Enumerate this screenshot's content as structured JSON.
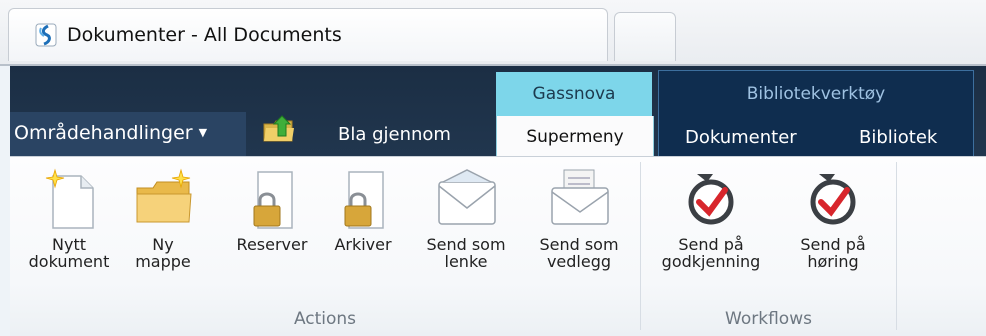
{
  "browser": {
    "tab_title": "Dokumenter - All Documents"
  },
  "ribbon": {
    "area_actions_label": "Områdehandlinger",
    "tabs": {
      "browse": "Bla gjennom",
      "gassnova_context": "Gassnova",
      "supermeny": "Supermeny",
      "library_tools_context": "Bibliotekverktøy",
      "documents": "Dokumenter",
      "library": "Bibliotek"
    },
    "groups": {
      "actions": "Actions",
      "workflows": "Workflows"
    },
    "commands": [
      {
        "label": "Nytt\ndokument",
        "icon": "new-document-icon"
      },
      {
        "label": "Ny\nmappe",
        "icon": "new-folder-icon"
      },
      {
        "label": "Reserver",
        "icon": "checkout-lock-icon"
      },
      {
        "label": "Arkiver",
        "icon": "archive-lock-icon"
      },
      {
        "label": "Send som\nlenke",
        "icon": "envelope-link-icon"
      },
      {
        "label": "Send som\nvedlegg",
        "icon": "envelope-attachment-icon"
      },
      {
        "label": "Send på\ngodkjenning",
        "icon": "workflow-approval-icon"
      },
      {
        "label": "Send på\nhøring",
        "icon": "workflow-review-icon"
      }
    ]
  },
  "colors": {
    "ribbon_dark": "#1b2e44",
    "gassnova_accent": "#7dd6ea",
    "library_tools_bg": "#0f2d4f",
    "checkmark_red": "#d8262c"
  }
}
